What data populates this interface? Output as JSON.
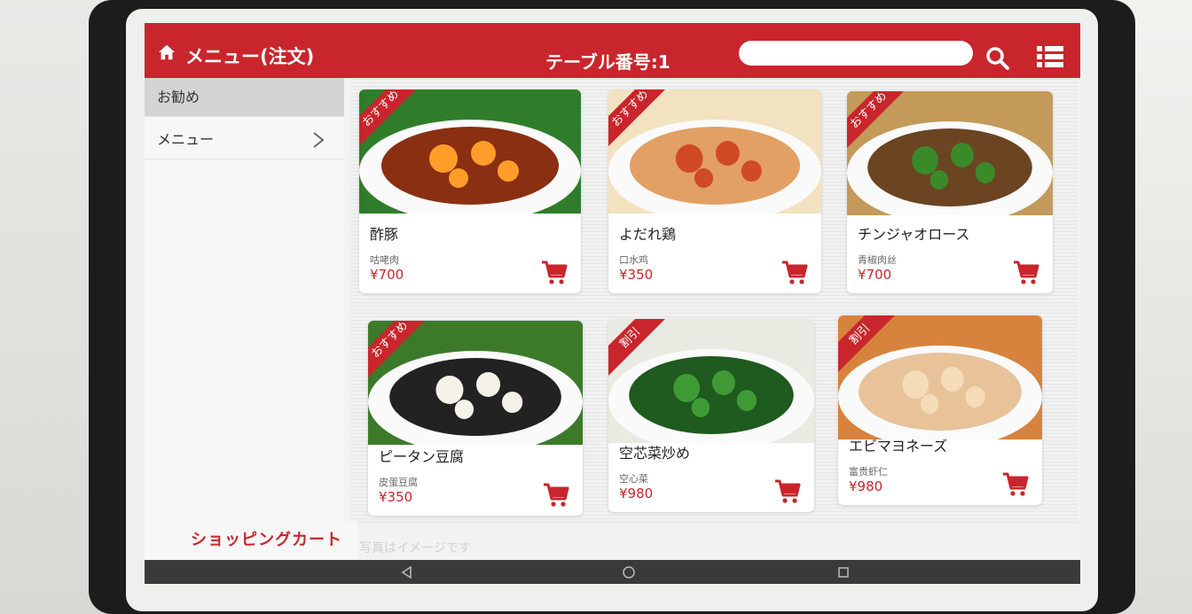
{
  "header": {
    "title": "メニュー(注文)",
    "table": "テーブル番号:1",
    "search_placeholder": "",
    "bg_color": "#c8262c"
  },
  "sidebar": {
    "items": [
      {
        "label": "お勧め",
        "selected": true
      },
      {
        "label": "メニュー",
        "selected": false
      }
    ],
    "cart_label": "ショッピングカート"
  },
  "watermark": "写真はイメージです",
  "dishes": [
    {
      "name": "酢豚",
      "cn_name": "咕咾肉",
      "price": "¥700",
      "badge": "おすすめ",
      "colors": [
        "#8a2f12",
        "#ff9d2a",
        "#2f7d2a"
      ]
    },
    {
      "name": "よだれ鶏",
      "cn_name": "口水鸡",
      "price": "¥350",
      "badge": "おすすめ",
      "colors": [
        "#e2a064",
        "#d04a24",
        "#f3e2c0"
      ]
    },
    {
      "name": "チンジャオロース",
      "cn_name": "青椒肉丝",
      "price": "¥700",
      "badge": "おすすめ",
      "colors": [
        "#6b4422",
        "#3a8a2a",
        "#c39a5a"
      ]
    },
    {
      "name": "ピータン豆腐",
      "cn_name": "皮蛋豆腐",
      "price": "¥350",
      "badge": "おすすめ",
      "colors": [
        "#222222",
        "#f5f2ea",
        "#3c7a2a"
      ]
    },
    {
      "name": "空芯菜炒め",
      "cn_name": "空心菜",
      "price": "¥980",
      "badge": "割引",
      "colors": [
        "#1f5a1e",
        "#3f9a36",
        "#e9ebe3"
      ]
    },
    {
      "name": "エビマヨネーズ",
      "cn_name": "富贵虾仁",
      "price": "¥980",
      "badge": "割引",
      "colors": [
        "#e8c39a",
        "#f4dcb8",
        "#d7833e"
      ]
    }
  ],
  "icons": {
    "home": "home-icon",
    "search": "search-icon",
    "list": "list-icon",
    "chevron": "chevron-right-icon",
    "cart": "shopping-cart-icon",
    "nav_back": "back-triangle-icon",
    "nav_home": "home-circle-icon",
    "nav_recent": "recent-square-icon"
  }
}
